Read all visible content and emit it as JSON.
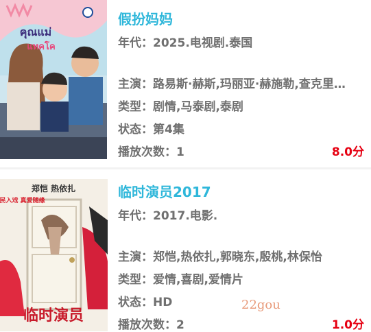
{
  "items": [
    {
      "title": "假扮妈妈",
      "era": "年代：2025.电视剧.泰国",
      "cast": "主演：路易斯·赫斯,玛丽亚·赫施勒,查克里…",
      "genre": "类型：剧情,马泰剧,泰剧",
      "status": "状态：第4集",
      "plays": "播放次数：1",
      "score": "8.0分",
      "poster": {
        "logo_text": "คุณแม่",
        "logo_sub": "แทคโค"
      }
    },
    {
      "title": "临时演员2017",
      "era": "年代：2017.电影.",
      "cast": "主演：郑恺,热依扎,郭晓东,殷桃,林保怡",
      "genre": "类型：爱情,喜剧,爱情片",
      "status": "状态：HD",
      "plays": "播放次数：2",
      "score": "1.0分",
      "poster": {
        "names": "郑恺   热依扎",
        "tagline": "全民入戏 真爱随缘",
        "logo_text": "临时演员"
      }
    }
  ],
  "watermark": "22gou"
}
